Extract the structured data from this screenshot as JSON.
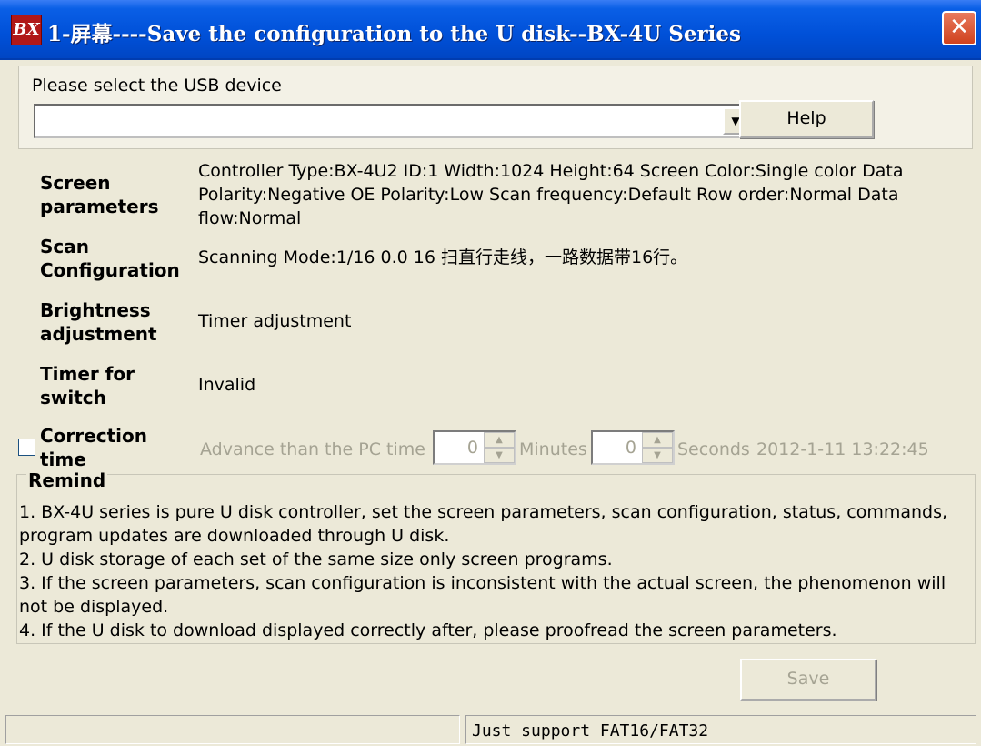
{
  "window": {
    "icon_text": "BX",
    "title": "1-屏幕----Save the configuration to the U disk--BX-4U Series",
    "close_glyph": "✕"
  },
  "usb": {
    "label": "Please select the USB device",
    "selected": "",
    "dropdown_glyph": "▼",
    "help_label": "Help"
  },
  "params": {
    "screen_label": "Screen parameters",
    "screen_value": "Controller Type:BX-4U2   ID:1   Width:1024   Height:64   Screen Color:Single color   Data Polarity:Negative   OE Polarity:Low   Scan frequency:Default   Row order:Normal   Data flow:Normal",
    "scan_label": "Scan Configuration",
    "scan_value": "Scanning Mode:1/16     0.0   16 扫直行走线，一路数据带16行。",
    "brightness_label": "Brightness adjustment",
    "brightness_value": "Timer adjustment",
    "timer_label": "Timer for switch",
    "timer_value": "Invalid"
  },
  "correction": {
    "label": "Correction time",
    "checked": false,
    "advance_label": "Advance than the PC time",
    "minutes_value": "0",
    "minutes_label": "Minutes",
    "seconds_value": "0",
    "seconds_label": "Seconds",
    "datetime": "2012-1-11 13:22:45"
  },
  "remind": {
    "title": "Remind",
    "line1": "  1.  BX-4U series is pure U disk controller, set the screen parameters, scan configuration, status, commands, program updates are downloaded through U disk.",
    "line2": "  2.  U disk storage of each set of the same size only screen programs.",
    "line3": "  3.  If the screen parameters, scan configuration is inconsistent with the actual screen, the phenomenon will not be displayed.",
    "line4": "  4.  If the U disk to download displayed correctly after, please proofread the screen parameters."
  },
  "footer": {
    "save_label": "Save",
    "status_left": "",
    "status_right": "Just support FAT16/FAT32"
  }
}
